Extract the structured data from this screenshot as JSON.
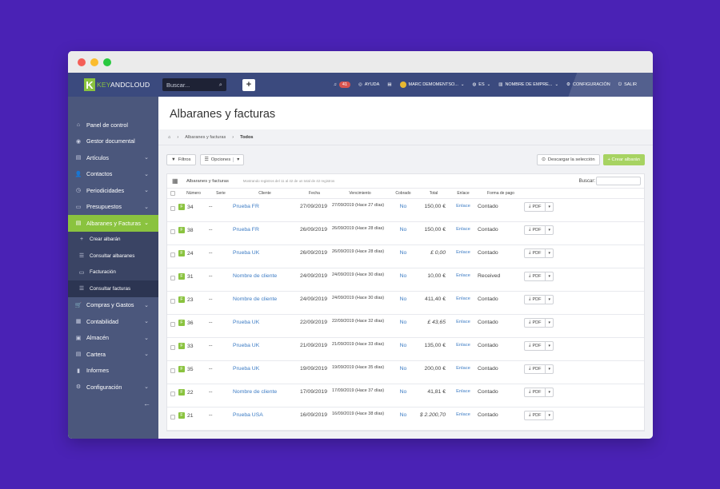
{
  "window": {
    "dots": [
      "#f45f58",
      "#fbbc2e",
      "#29c940"
    ]
  },
  "topbar": {
    "logo_k": "K",
    "logo_a": "KEY",
    "logo_b": "ANDCLOUD",
    "search_placeholder": "Buscar...",
    "plus": "+",
    "notif_count": "41",
    "help": "AYUDA",
    "user": "MARC DEMOMENTSO...",
    "lang": "ES",
    "company": "NOMBRE DE EMPRE...",
    "config": "CONFIGURACIÓN",
    "exit": "SALIR"
  },
  "sidebar": {
    "items": [
      {
        "label": "Panel de control",
        "icon": "home-icon",
        "glyph": "⌂"
      },
      {
        "label": "Gestor documental",
        "icon": "document-manager-icon",
        "glyph": "◉"
      },
      {
        "label": "Artículos",
        "icon": "articles-icon",
        "glyph": "▤",
        "chev": "⌄"
      },
      {
        "label": "Contactos",
        "icon": "contacts-icon",
        "glyph": "👤",
        "chev": "⌄"
      },
      {
        "label": "Periodicidades",
        "icon": "clock-icon",
        "glyph": "◷",
        "chev": "⌄"
      },
      {
        "label": "Presupuestos",
        "icon": "budget-icon",
        "glyph": "▭",
        "chev": "⌄"
      },
      {
        "label": "Albaranes y Facturas",
        "icon": "invoice-icon",
        "glyph": "▤",
        "chev": "⌄"
      }
    ],
    "sub": [
      {
        "label": "Crear albarán",
        "glyph": "+"
      },
      {
        "label": "Consultar albaranes",
        "glyph": "☰"
      },
      {
        "label": "Facturación",
        "glyph": "▭"
      },
      {
        "label": "Consultar facturas",
        "glyph": "☰"
      }
    ],
    "items2": [
      {
        "label": "Compras y Gastos",
        "icon": "cart-icon",
        "glyph": "🛒",
        "chev": "⌄"
      },
      {
        "label": "Contabilidad",
        "icon": "accounting-icon",
        "glyph": "▦",
        "chev": "⌄"
      },
      {
        "label": "Almacén",
        "icon": "warehouse-icon",
        "glyph": "▣",
        "chev": "⌄"
      },
      {
        "label": "Cartera",
        "icon": "wallet-icon",
        "glyph": "▤",
        "chev": "⌄"
      },
      {
        "label": "Informes",
        "icon": "reports-icon",
        "glyph": "▮"
      },
      {
        "label": "Configuración",
        "icon": "gear-icon",
        "glyph": "⚙",
        "chev": "⌄"
      }
    ],
    "back": "←"
  },
  "page": {
    "title": "Albaranes y facturas",
    "crumb_section": "Albaranes y facturas",
    "crumb_current": "Todos"
  },
  "toolbar": {
    "filters": "Filtros",
    "options": "Opciones",
    "download": "Descargar la selección",
    "create": "+ Crear albarán"
  },
  "panel": {
    "title": "Albaranes y facturas",
    "info": "Mostrando registros del 11 al 42 de un total de 42 registros",
    "search_label": "Buscar:"
  },
  "table": {
    "headers": [
      "",
      "Número",
      "Serie",
      "Cliente",
      "Fecha",
      "Vencimiento",
      "Cobrado",
      "Total",
      "Enlace",
      "Forma de pago",
      ""
    ],
    "rows": [
      {
        "num": "34",
        "serie": "--",
        "cliente": "Prueba FR",
        "fecha": "27/09/2019",
        "venc": "27/09/2019 (Hace 27 días)",
        "cobrado": "No",
        "total": "150,00 €",
        "enlace": "Enlace",
        "pago": "Contado"
      },
      {
        "num": "38",
        "serie": "--",
        "cliente": "Prueba FR",
        "fecha": "26/09/2019",
        "venc": "26/09/2019 (Hace 28 días)",
        "cobrado": "No",
        "total": "150,00 €",
        "enlace": "Enlace",
        "pago": "Contado"
      },
      {
        "num": "24",
        "serie": "--",
        "cliente": "Prueba UK",
        "fecha": "26/09/2019",
        "venc": "26/09/2019 (Hace 28 días)",
        "cobrado": "No",
        "total": "£ 0,00",
        "enlace": "Enlace",
        "pago": "Contado"
      },
      {
        "num": "31",
        "serie": "--",
        "cliente": "Nombre de cliente",
        "fecha": "24/09/2019",
        "venc": "24/09/2019 (Hace 30 días)",
        "cobrado": "No",
        "total": "10,00 €",
        "enlace": "Enlace",
        "pago": "Received"
      },
      {
        "num": "23",
        "serie": "--",
        "cliente": "Nombre de cliente",
        "fecha": "24/09/2019",
        "venc": "24/09/2019 (Hace 30 días)",
        "cobrado": "No",
        "total": "411,40 €",
        "enlace": "Enlace",
        "pago": "Contado"
      },
      {
        "num": "36",
        "serie": "--",
        "cliente": "Prueba UK",
        "fecha": "22/09/2019",
        "venc": "22/09/2019 (Hace 32 días)",
        "cobrado": "No",
        "total": "£ 43,65",
        "enlace": "Enlace",
        "pago": "Contado"
      },
      {
        "num": "33",
        "serie": "--",
        "cliente": "Prueba UK",
        "fecha": "21/09/2019",
        "venc": "21/09/2019 (Hace 33 días)",
        "cobrado": "No",
        "total": "135,00 €",
        "enlace": "Enlace",
        "pago": "Contado"
      },
      {
        "num": "35",
        "serie": "--",
        "cliente": "Prueba UK",
        "fecha": "19/09/2019",
        "venc": "19/09/2019 (Hace 35 días)",
        "cobrado": "No",
        "total": "200,00 €",
        "enlace": "Enlace",
        "pago": "Contado"
      },
      {
        "num": "22",
        "serie": "--",
        "cliente": "Nombre de cliente",
        "fecha": "17/09/2019",
        "venc": "17/09/2019 (Hace 37 días)",
        "cobrado": "No",
        "total": "41,81 €",
        "enlace": "Enlace",
        "pago": "Contado"
      },
      {
        "num": "21",
        "serie": "--",
        "cliente": "Prueba USA",
        "fecha": "16/09/2019",
        "venc": "16/09/2019 (Hace 38 días)",
        "cobrado": "No",
        "total": "$ 2.200,70",
        "enlace": "Enlace",
        "pago": "Contado"
      }
    ],
    "row_badge": "F",
    "pdf_label": "PDF"
  }
}
